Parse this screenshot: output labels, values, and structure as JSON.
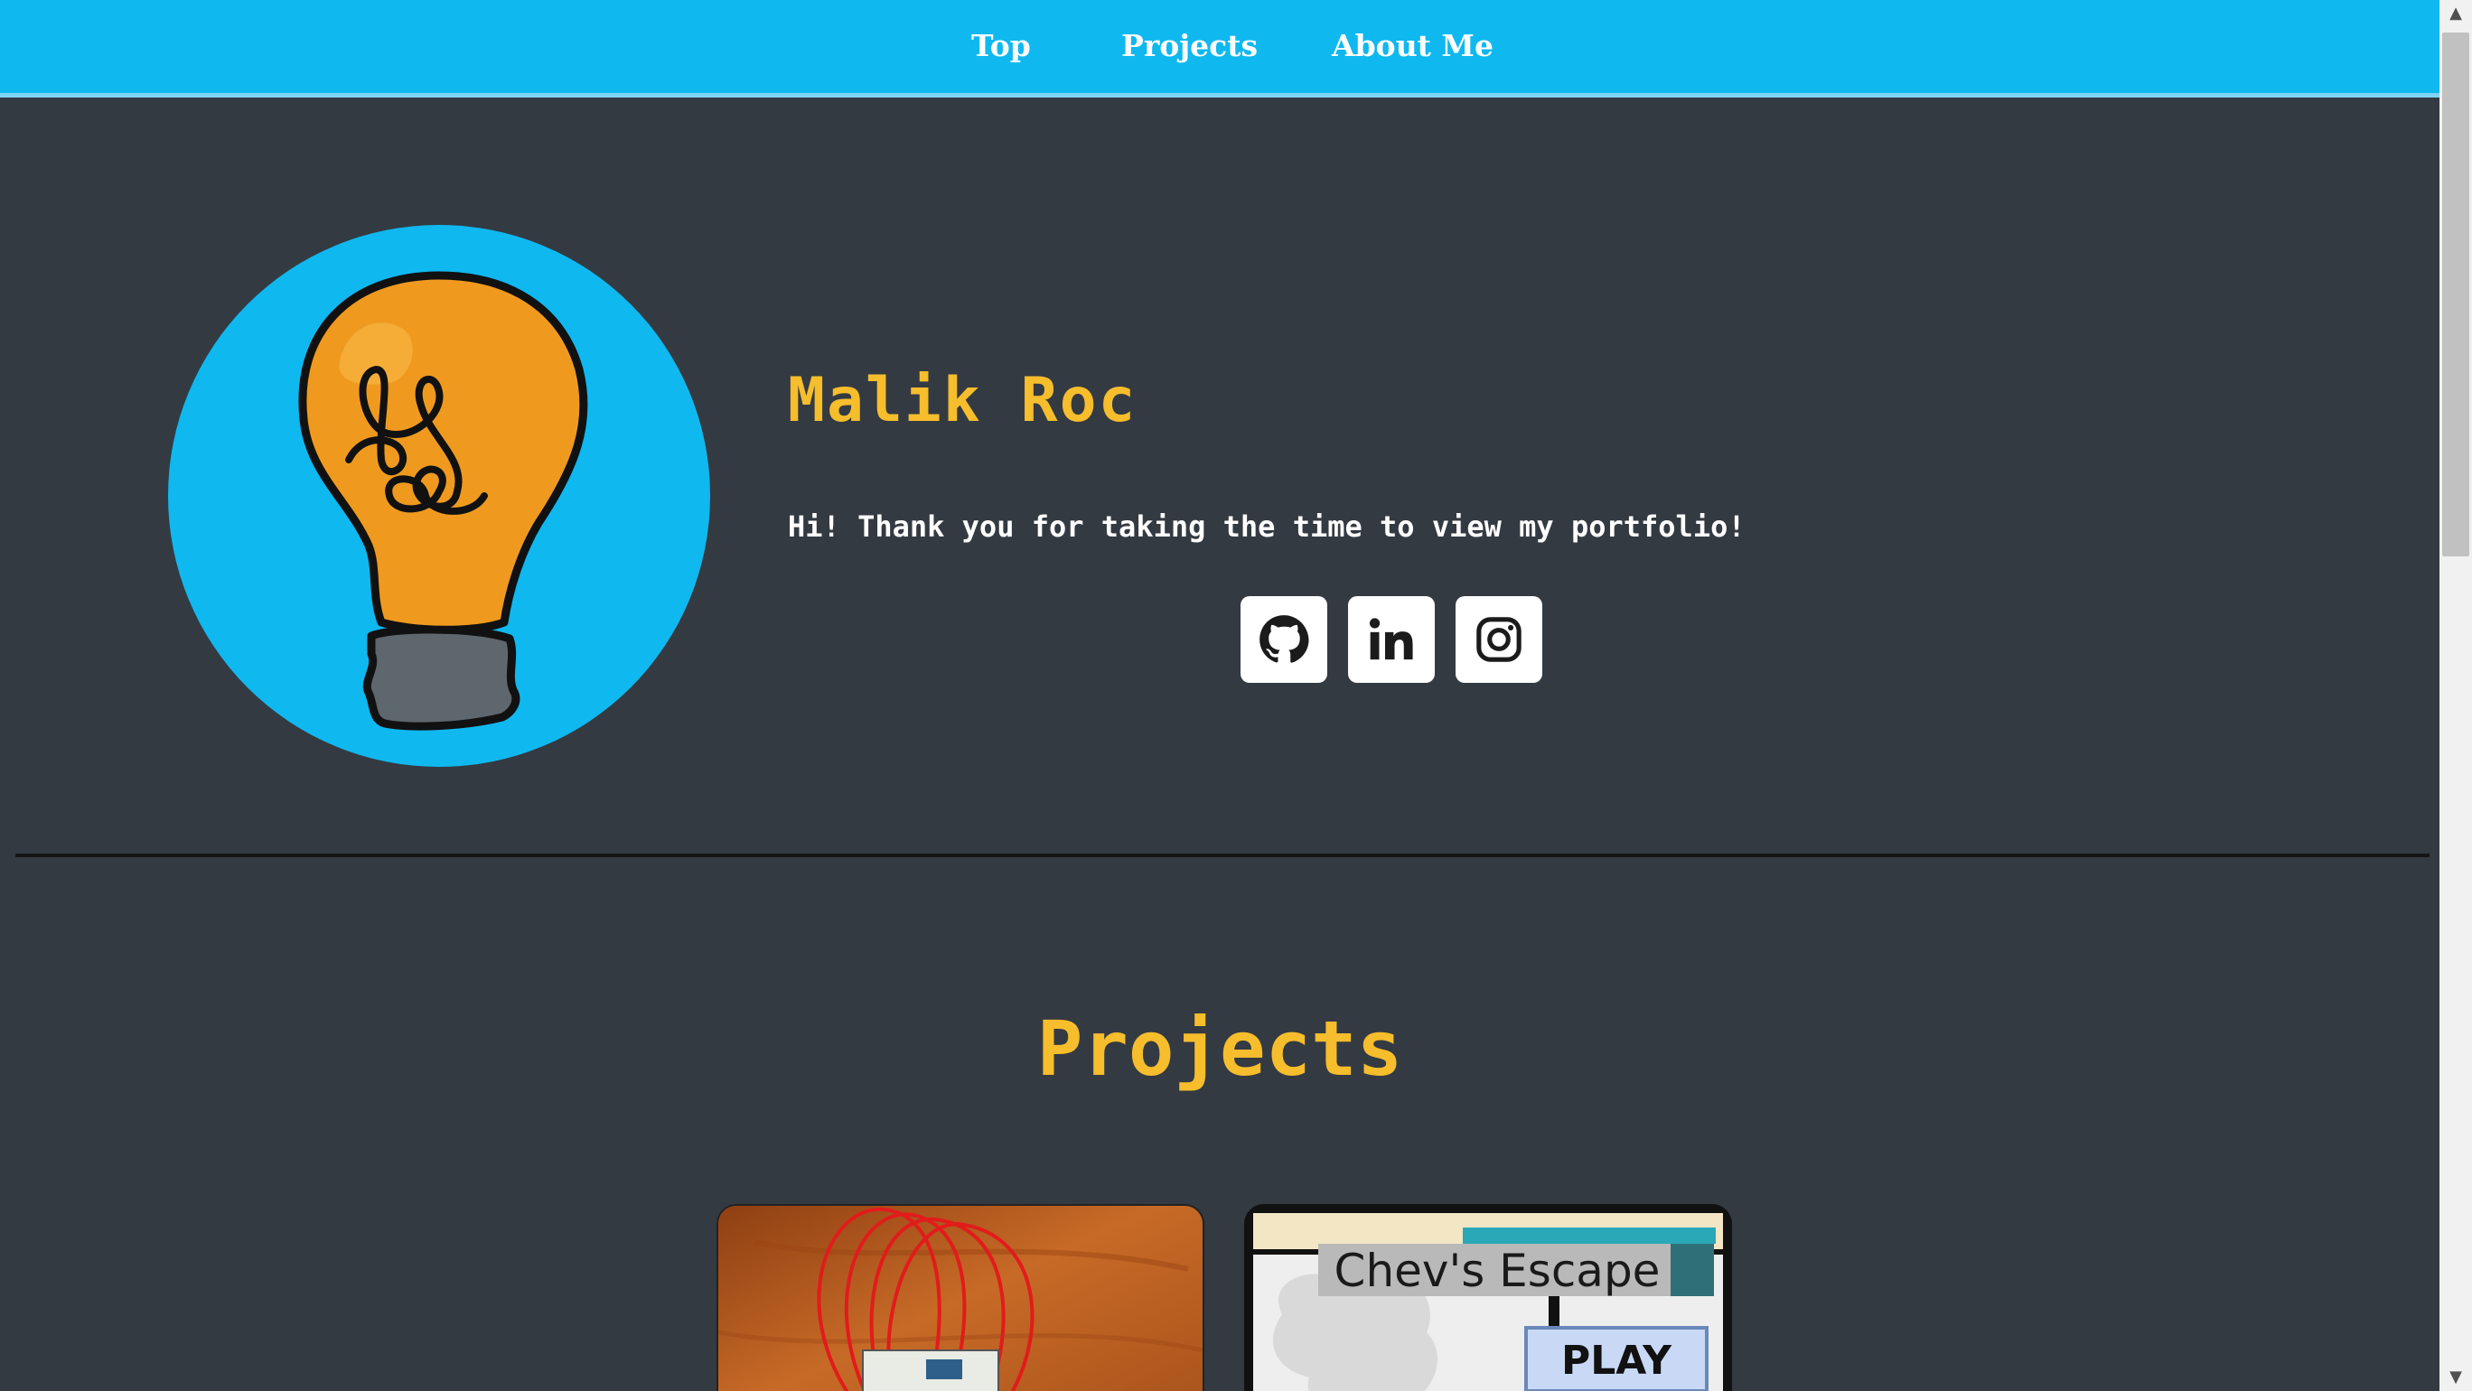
{
  "nav": {
    "links": [
      {
        "label": "Top"
      },
      {
        "label": "Projects"
      },
      {
        "label": "About Me"
      }
    ]
  },
  "hero": {
    "avatar_icon": "lightbulb-icon",
    "name": "Malik Roc",
    "tagline": "Hi! Thank you for taking the time to view my portfolio!",
    "social": [
      {
        "icon": "github-icon"
      },
      {
        "icon": "linkedin-icon"
      },
      {
        "icon": "instagram-icon"
      }
    ]
  },
  "projects": {
    "title": "Projects",
    "cards": [
      {
        "image": "arduino-wiring-photo"
      },
      {
        "image": "game-title-screen",
        "overlay_title": "Chev's Escape",
        "overlay_button": "PLAY"
      }
    ]
  },
  "colors": {
    "navbar": "#10b8f0",
    "background": "#343a42",
    "accent": "#f6bd2c",
    "text": "#ffffff"
  }
}
